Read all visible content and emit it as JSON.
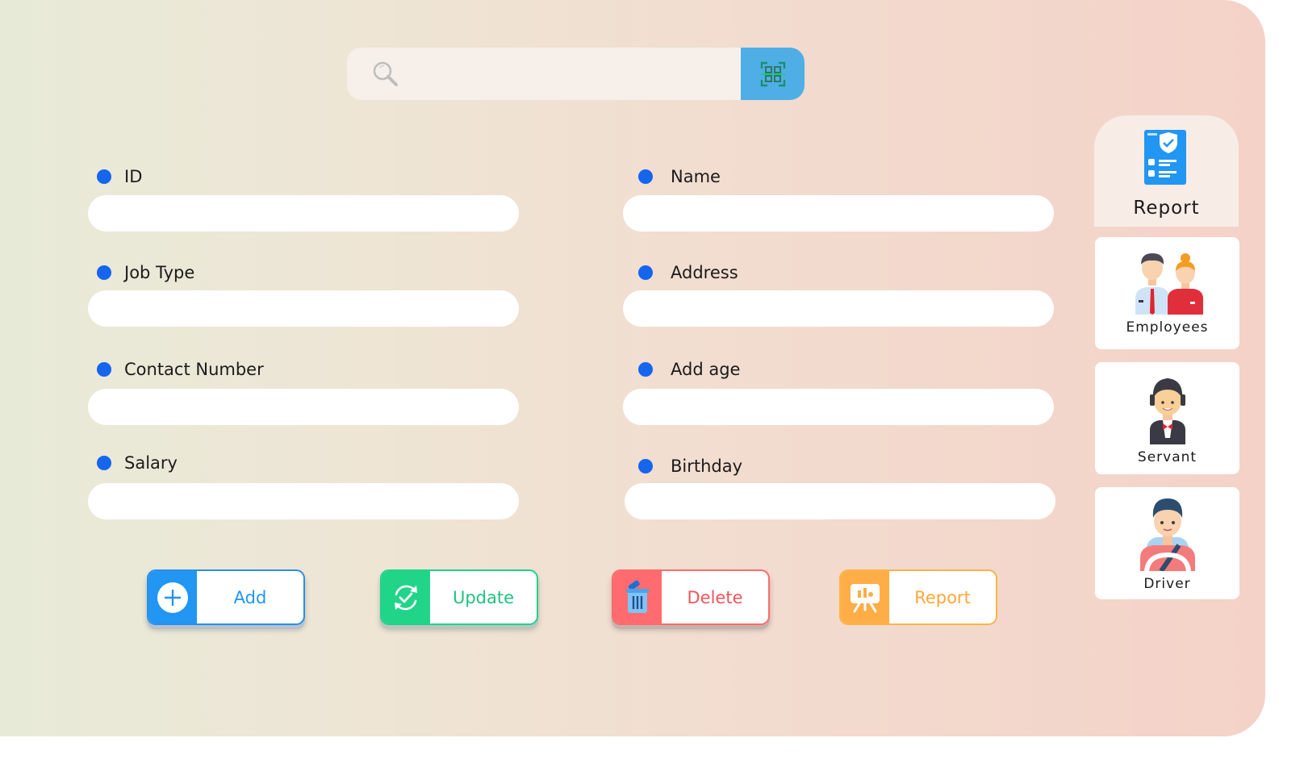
{
  "search": {
    "placeholder": "",
    "value": "",
    "icon": "search-icon",
    "scan_icon": "qr-scan-icon",
    "scan_color": "#4faee6"
  },
  "form": {
    "accent": "#1565ef",
    "fields": [
      {
        "label": "ID",
        "value": ""
      },
      {
        "label": "Name",
        "value": ""
      },
      {
        "label": "Job Type",
        "value": ""
      },
      {
        "label": "Address",
        "value": ""
      },
      {
        "label": "Contact Number",
        "value": ""
      },
      {
        "label": "Add age",
        "value": ""
      },
      {
        "label": "Salary",
        "value": ""
      },
      {
        "label": "Birthday",
        "value": ""
      }
    ]
  },
  "actions": {
    "add": {
      "label": "Add",
      "color": "#2196f3",
      "icon": "plus-icon"
    },
    "update": {
      "label": "Update",
      "color": "#20d488",
      "icon": "refresh-check-icon"
    },
    "delete": {
      "label": "Delete",
      "color": "#ff6b6e",
      "icon": "trash-icon"
    },
    "report": {
      "label": "Report",
      "color": "#ffad47",
      "icon": "presentation-chart-icon"
    }
  },
  "sidebar": {
    "items": [
      {
        "label": "Report",
        "icon": "report-clipboard-icon",
        "active": true
      },
      {
        "label": "Employees",
        "icon": "employees-icon"
      },
      {
        "label": "Servant",
        "icon": "servant-icon"
      },
      {
        "label": "Driver",
        "icon": "driver-icon"
      }
    ]
  }
}
